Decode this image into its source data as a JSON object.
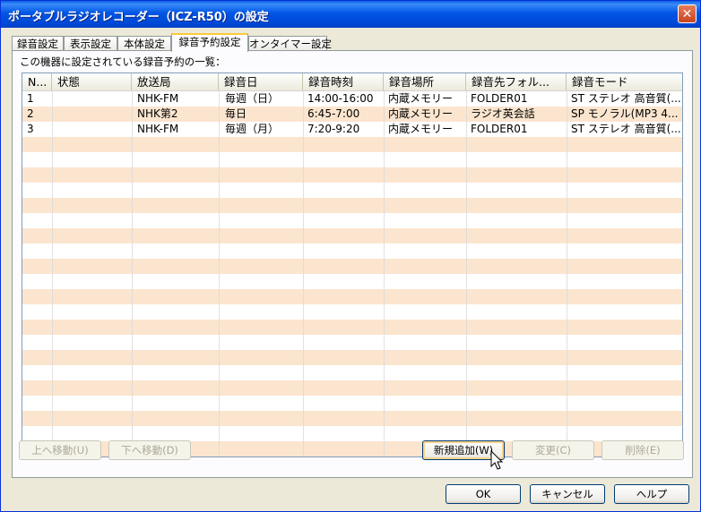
{
  "window": {
    "title": "ポータブルラジオレコーダー（ICZ-R50）の設定",
    "close_glyph": "✕"
  },
  "tabs": [
    {
      "label": "録音設定",
      "active": false
    },
    {
      "label": "表示設定",
      "active": false
    },
    {
      "label": "本体設定",
      "active": false
    },
    {
      "label": "録音予約設定",
      "active": true
    },
    {
      "label": "オンタイマー設定",
      "active": false
    }
  ],
  "panel": {
    "caption": "この機器に設定されている録音予約の一覧："
  },
  "list": {
    "columns": [
      "N...",
      "状態",
      "放送局",
      "録音日",
      "録音時刻",
      "録音場所",
      "録音先フォル...",
      "録音モード"
    ],
    "rows": [
      [
        "1",
        "",
        "NHK-FM",
        "毎週（日）",
        "14:00-16:00",
        "内蔵メモリー",
        "FOLDER01",
        "ST ステレオ 高音質(..."
      ],
      [
        "2",
        "",
        "NHK第2",
        "毎日",
        "6:45-7:00",
        "内蔵メモリー",
        "ラジオ英会話",
        "SP モノラル(MP3 4..."
      ],
      [
        "3",
        "",
        "NHK-FM",
        "毎週（月）",
        "7:20-9:20",
        "内蔵メモリー",
        "FOLDER01",
        "ST ステレオ 高音質(..."
      ]
    ],
    "colors": {
      "row_even": "#ffffff",
      "row_odd": "#fbe5cf"
    }
  },
  "buttons": {
    "move_up": "上へ移動(U)",
    "move_down": "下へ移動(D)",
    "new_add": "新規追加(W)",
    "change": "変更(C)",
    "delete": "削除(E)",
    "ok": "OK",
    "cancel": "キャンセル",
    "help": "ヘルプ"
  }
}
